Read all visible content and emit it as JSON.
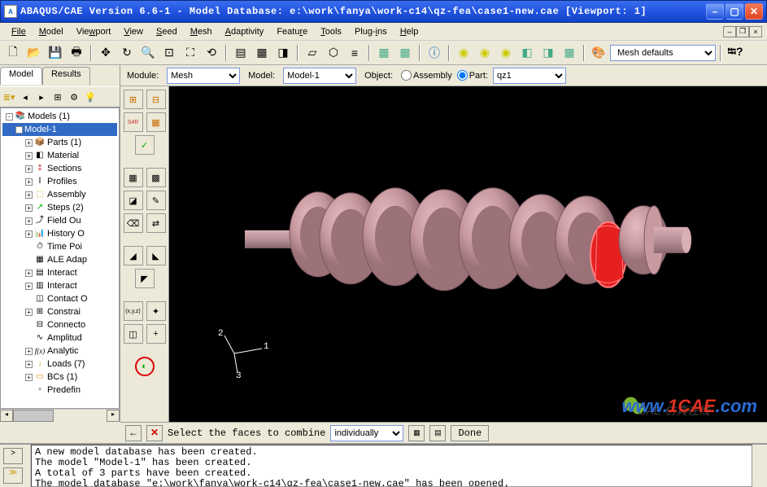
{
  "title": "ABAQUS/CAE Version 6.6-1 - Model Database: e:\\work\\fanya\\work-c14\\qz-fea\\case1-new.cae [Viewport: 1]",
  "menus": [
    "File",
    "Model",
    "Viewport",
    "View",
    "Seed",
    "Mesh",
    "Adaptivity",
    "Feature",
    "Tools",
    "Plug-ins",
    "Help"
  ],
  "tabs": {
    "model": "Model",
    "results": "Results"
  },
  "context": {
    "module_label": "Module:",
    "module_value": "Mesh",
    "model_label": "Model:",
    "model_value": "Model-1",
    "object_label": "Object:",
    "assembly_label": "Assembly",
    "part_label": "Part:",
    "part_value": "qz1"
  },
  "toolbar2": {
    "meshdefaults_label": "Mesh defaults"
  },
  "tree": {
    "root": "Models (1)",
    "model": "Model-1",
    "items": [
      {
        "icon": "📦",
        "label": "Parts (1)"
      },
      {
        "icon": "◧",
        "label": "Material"
      },
      {
        "icon": "‡",
        "label": "Sections"
      },
      {
        "icon": "Ⅰ",
        "label": "Profiles"
      },
      {
        "icon": "⬚",
        "label": "Assembly"
      },
      {
        "icon": "↗",
        "label": "Steps (2)"
      },
      {
        "icon": "⤴",
        "label": "Field Ou"
      },
      {
        "icon": "📊",
        "label": "History O"
      },
      {
        "icon": "⏱",
        "label": "Time Poi"
      },
      {
        "icon": "▦",
        "label": "ALE Adap"
      },
      {
        "icon": "▤",
        "label": "Interact"
      },
      {
        "icon": "▥",
        "label": "Interact"
      },
      {
        "icon": "◫",
        "label": "Contact O"
      },
      {
        "icon": "⊞",
        "label": "Constrai"
      },
      {
        "icon": "⊟",
        "label": "Connecto"
      },
      {
        "icon": "∿",
        "label": "Amplitud"
      },
      {
        "icon": "f(x)",
        "label": "Analytic"
      },
      {
        "icon": "↓",
        "label": "Loads (7)"
      },
      {
        "icon": "▭",
        "label": "BCs (1)"
      },
      {
        "icon": "▫",
        "label": "Predefin"
      }
    ]
  },
  "prompt": {
    "text": "Select the faces to combine",
    "mode_value": "individually",
    "done": "Done"
  },
  "messages": [
    "A new model database has been created.",
    "The model \"Model-1\" has been created.",
    "A total of 3 parts have been created.",
    "The model database \"e:\\work\\fanya\\work-c14\\qz-fea\\case1-new.cae\" has been opened."
  ],
  "watermark": {
    "text1": "www.",
    "text2": "1CAE",
    "text3": ".com",
    "cae": "CAE",
    "fz": "仿真在线"
  },
  "triad": {
    "a": "2",
    "b": "1",
    "c": "3"
  }
}
